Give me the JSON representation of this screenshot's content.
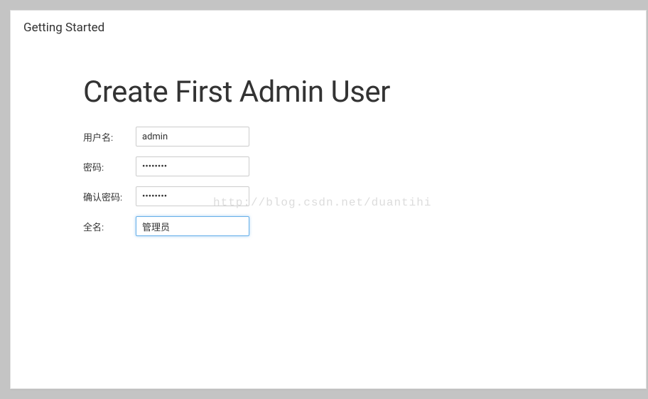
{
  "header": {
    "title": "Getting Started"
  },
  "main": {
    "heading": "Create First Admin User"
  },
  "form": {
    "username": {
      "label": "用户名:",
      "value": "admin"
    },
    "password": {
      "label": "密码:",
      "value": "••••••••"
    },
    "confirm": {
      "label": "确认密码:",
      "value": "••••••••"
    },
    "fullname": {
      "label": "全名:",
      "value": "管理员"
    }
  },
  "watermark": "http://blog.csdn.net/duantihi"
}
